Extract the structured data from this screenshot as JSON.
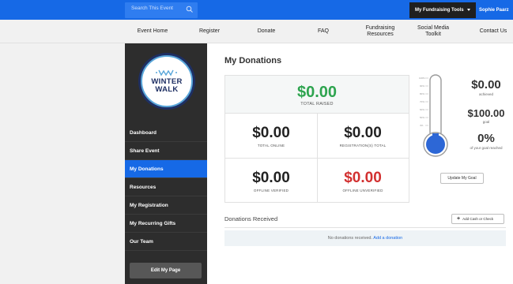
{
  "topbar": {
    "search_placeholder": "Search This Event",
    "tools_label": "My Fundraising Tools",
    "user_name": "Sophie Paarz"
  },
  "nav": {
    "items": [
      {
        "label": "Event Home"
      },
      {
        "label": "Register"
      },
      {
        "label": "Donate"
      },
      {
        "label": "FAQ"
      },
      {
        "label": "Fundraising Resources"
      },
      {
        "label": "Social Media Toolkit"
      },
      {
        "label": "Contact Us"
      }
    ]
  },
  "sidebar": {
    "logo": {
      "line1": "WINTER",
      "line2": "WALK"
    },
    "items": [
      {
        "label": "Dashboard"
      },
      {
        "label": "Share Event"
      },
      {
        "label": "My Donations"
      },
      {
        "label": "Resources"
      },
      {
        "label": "My Registration"
      },
      {
        "label": "My Recurring Gifts"
      },
      {
        "label": "Our Team"
      }
    ],
    "edit_button": "Edit My Page"
  },
  "main": {
    "title": "My Donations",
    "total": {
      "amount": "$0.00",
      "label": "TOTAL RAISED"
    },
    "cells": [
      {
        "amount": "$0.00",
        "label": "TOTAL ONLINE"
      },
      {
        "amount": "$0.00",
        "label": "REGISTRATION(S) TOTAL"
      },
      {
        "amount": "$0.00",
        "label": "OFFLINE VERIFIED"
      },
      {
        "amount": "$0.00",
        "label": "OFFLINE UNVERIFIED"
      }
    ],
    "goal": {
      "achieved_amount": "$0.00",
      "achieved_label": "achieved",
      "goal_amount": "$100.00",
      "goal_label": "goal",
      "percent": "0%",
      "percent_label": "of your goal reached",
      "progress": 0
    },
    "update_goal_button": "Update My Goal",
    "received": {
      "title": "Donations Received",
      "add_button": "Add Cash or Check",
      "empty_text": "No donations received.",
      "empty_link": "Add a donation"
    }
  },
  "colors": {
    "primary_blue": "#1669e6",
    "sidebar_dark": "#2d2d2d",
    "green": "#2ea44f",
    "red": "#d23030"
  }
}
